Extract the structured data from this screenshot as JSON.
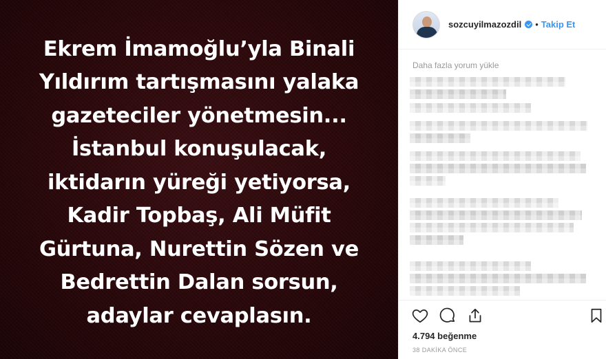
{
  "post": {
    "image_text_lines": [
      "Ekrem İmamoğlu’yla Binali",
      "Yıldırım tartışmasını yalaka",
      "gazeteciler yönetmesin...",
      "İstanbul konuşulacak,",
      "iktidarın yüreği yetiyorsa,",
      "Kadir Topbaş, Ali Müfit",
      "Gürtuna, Nurettin Sözen ve",
      "Bedrettin Dalan sorsun,",
      "adaylar cevaplasın."
    ],
    "background_color": "#2a080b"
  },
  "header": {
    "username": "sozcuyilmazozdil",
    "separator": "•",
    "follow_label": "Takip Et",
    "accent_color": "#3897f0"
  },
  "comments": {
    "load_more_label": "Daha fazla yorum yükle"
  },
  "actions": {
    "icons": [
      "heart-icon",
      "comment-icon",
      "share-icon",
      "bookmark-icon"
    ],
    "likes_text": "4.794 beğenme",
    "timestamp": "38 DAKİKA ÖNCE"
  }
}
